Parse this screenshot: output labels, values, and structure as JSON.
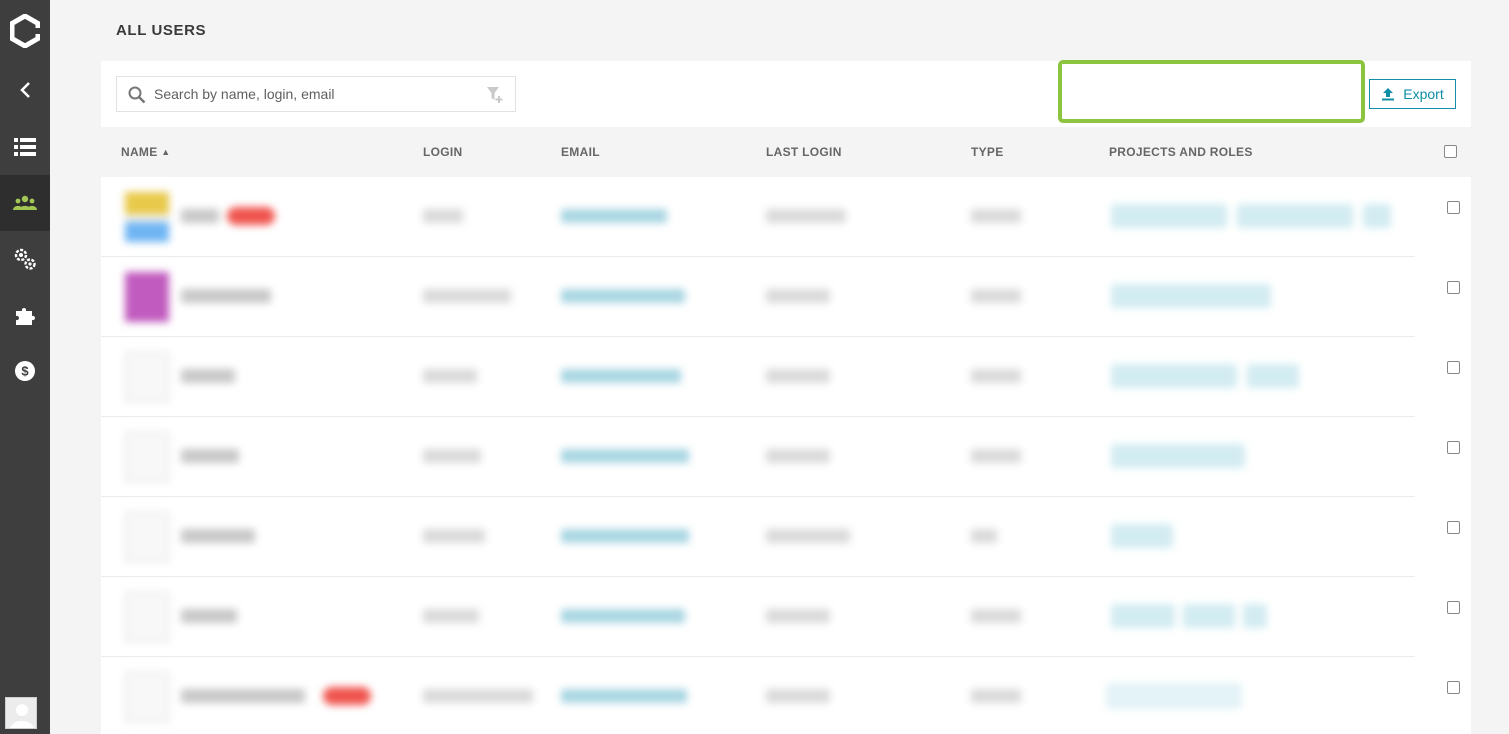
{
  "page": {
    "title": "ALL USERS"
  },
  "sidebar": {
    "items": [
      {
        "name": "back",
        "icon": "chevron-left-icon"
      },
      {
        "name": "projects",
        "icon": "list-icon"
      },
      {
        "name": "users",
        "icon": "users-icon",
        "active": true
      },
      {
        "name": "settings",
        "icon": "gears-icon"
      },
      {
        "name": "plugins",
        "icon": "puzzle-icon"
      },
      {
        "name": "billing",
        "icon": "dollar-icon"
      }
    ]
  },
  "toolbar": {
    "search_placeholder": "Search by name, login, email",
    "export_label": "Export"
  },
  "table": {
    "columns": [
      {
        "key": "name",
        "label": "NAME",
        "sorted": "asc"
      },
      {
        "key": "login",
        "label": "LOGIN"
      },
      {
        "key": "email",
        "label": "EMAIL"
      },
      {
        "key": "last_login",
        "label": "LAST LOGIN"
      },
      {
        "key": "type",
        "label": "TYPE"
      },
      {
        "key": "projects_roles",
        "label": "PROJECTS AND ROLES"
      }
    ],
    "rows_note": "row contents are blurred / unreadable in screenshot"
  },
  "colors": {
    "sidebar_bg": "#3e3e3e",
    "active_icon": "#a2c754",
    "accent": "#0f8ea5",
    "highlight": "#8dc43f",
    "badge": "#f0554f"
  }
}
